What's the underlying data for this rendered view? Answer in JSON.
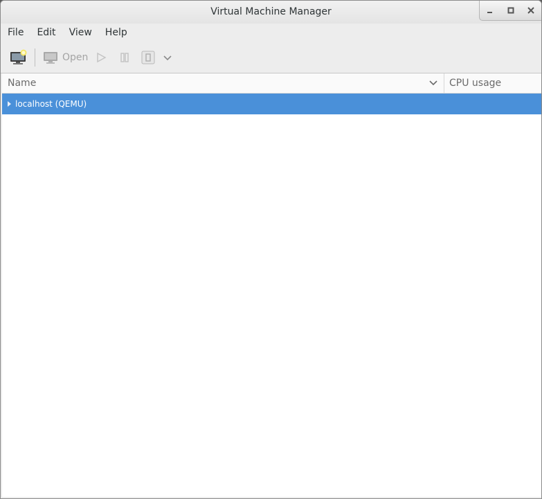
{
  "window": {
    "title": "Virtual Machine Manager"
  },
  "wm": {
    "minimize_icon": "minimize-icon",
    "maximize_icon": "maximize-icon",
    "close_icon": "close-icon"
  },
  "menu": {
    "items": [
      "File",
      "Edit",
      "View",
      "Help"
    ]
  },
  "toolbar": {
    "new_vm_icon": "new-vm-icon",
    "open_label": "Open",
    "run_icon": "play-icon",
    "pause_icon": "pause-icon",
    "shutdown_icon": "shutdown-icon",
    "dropdown_icon": "chevron-down-icon"
  },
  "table": {
    "columns": [
      "Name",
      "CPU usage"
    ],
    "rows": [
      {
        "label": "localhost (QEMU)",
        "selected": true
      }
    ]
  },
  "colors": {
    "selection": "#4a90d9",
    "background": "#ededed",
    "list_bg": "#ffffff"
  }
}
